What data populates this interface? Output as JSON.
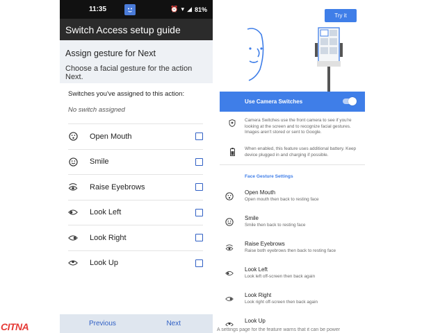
{
  "left_phone": {
    "status": {
      "time": "11:35",
      "battery": "81%"
    },
    "toolbar_title": "Switch Access setup guide",
    "header_title": "Assign gesture for Next",
    "header_sub": "Choose a facial gesture for the action Next.",
    "assigned_label": "Switches you've assigned to this action:",
    "no_switch": "No switch assigned",
    "gestures": [
      {
        "label": "Open Mouth",
        "icon": "open-mouth-icon"
      },
      {
        "label": "Smile",
        "icon": "smile-icon"
      },
      {
        "label": "Raise Eyebrows",
        "icon": "raise-eyebrows-icon"
      },
      {
        "label": "Look Left",
        "icon": "look-left-icon"
      },
      {
        "label": "Look Right",
        "icon": "look-right-icon"
      },
      {
        "label": "Look Up",
        "icon": "look-up-icon"
      }
    ],
    "nav": {
      "previous": "Previous",
      "next": "Next"
    }
  },
  "right_phone": {
    "try_button": "Try it",
    "camera_switch_label": "Use Camera Switches",
    "info": [
      {
        "icon": "face-id-icon",
        "text": "Camera Switches use the front camera to see if you're looking at the screen and to recognize facial gestures. Images aren't stored or sent to Google."
      },
      {
        "icon": "battery-icon",
        "text": "When enabled, this feature uses additional battery. Keep device plugged in and charging if possible."
      }
    ],
    "settings_head": "Face Gesture Settings",
    "settings": [
      {
        "title": "Open Mouth",
        "sub": "Open mouth then back to resting face"
      },
      {
        "title": "Smile",
        "sub": "Smile then back to resting face"
      },
      {
        "title": "Raise Eyebrows",
        "sub": "Raise both eyebrows then back to resting face"
      },
      {
        "title": "Look Left",
        "sub": "Look left off-screen then back again"
      },
      {
        "title": "Look Right",
        "sub": "Look right off-screen then back again"
      },
      {
        "title": "Look Up",
        "sub": ""
      }
    ]
  },
  "caption": "A settings page for the feature warns that it can be power",
  "logo": "CITNA",
  "colors": {
    "accent": "#3f7ee8",
    "checkbox": "#2f5fc4",
    "logo": "#e53935"
  }
}
